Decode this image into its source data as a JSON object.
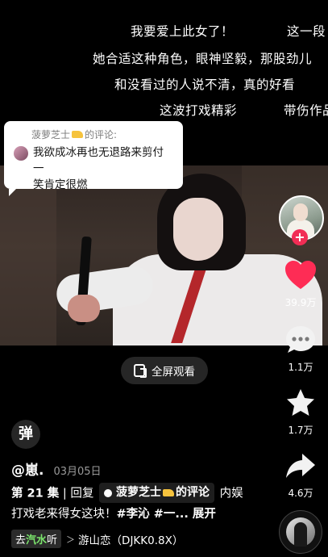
{
  "danmaku": [
    "我要爱上此女了！",
    "这一段",
    "她合适这种角色，眼神坚毅，那股劲儿",
    "和没看过的人说不清，真的好看",
    "这波打戏精彩",
    "带伤作品"
  ],
  "comment_bubble": {
    "user": "菠萝芝士",
    "suffix": "的评论:",
    "text_line1": "我欲成冰再也无退路来剪付一",
    "text_line2": "笑肯定很燃"
  },
  "rail": {
    "like_count": "39.9万",
    "comment_count": "1.1万",
    "favorite_count": "1.7万",
    "share_count": "4.6万",
    "follow_plus": "+"
  },
  "fullscreen_label": "全屏观看",
  "barrage_label": "弹",
  "author": {
    "name": "@崽.",
    "date": "03月05日"
  },
  "caption": {
    "episode": "第 21 集",
    "sep": " | 回复",
    "reply_user": "菠萝芝士",
    "reply_suffix": "的评论",
    "text_a": " 内娱",
    "text_b": "打戏老来得女这块！",
    "hashtag": "#李沁 #一...",
    "more": " 展开"
  },
  "music": {
    "tag_prefix": "去",
    "tag_brand": "汽水",
    "tag_suffix": "听",
    "arrow": "＞",
    "title": "游山恋（DJKK0.8X）"
  },
  "colors": {
    "accent_red": "#f12d55",
    "like": "#fe2c55",
    "qishui_green": "#7be46c"
  }
}
